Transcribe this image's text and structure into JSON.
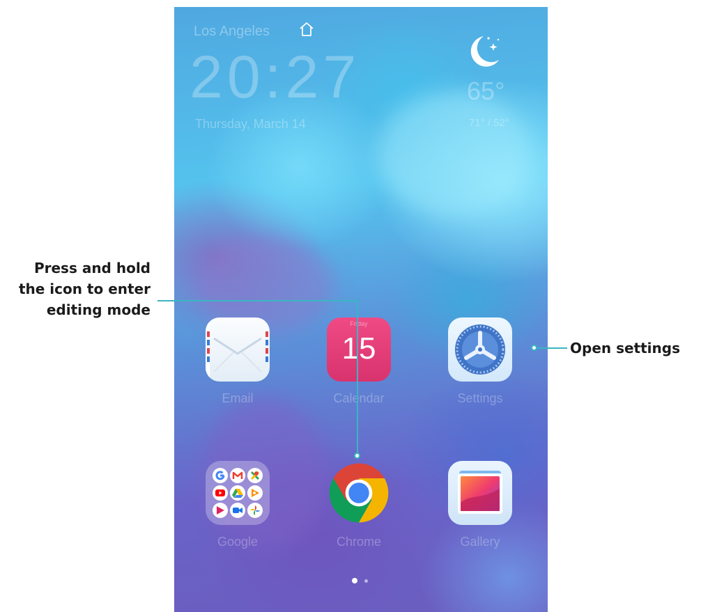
{
  "widget": {
    "city": "Los Angeles",
    "time": "20:27",
    "date": "Thursday, March 14",
    "temperature": "65°",
    "range": "71° / 52°"
  },
  "apps": {
    "email": {
      "label": "Email",
      "icon": "email-icon"
    },
    "calendar": {
      "label": "Calendar",
      "day": "Friday",
      "date": "15",
      "icon": "calendar-icon"
    },
    "settings": {
      "label": "Settings",
      "icon": "settings-icon"
    },
    "google": {
      "label": "Google",
      "icon": "google-folder-icon"
    },
    "chrome": {
      "label": "Chrome",
      "icon": "chrome-icon"
    },
    "gallery": {
      "label": "Gallery",
      "icon": "gallery-icon"
    }
  },
  "pager": {
    "pages": 2,
    "current": 1
  },
  "callouts": {
    "left": [
      "Press and hold",
      "the icon to enter",
      "editing mode"
    ],
    "right": "Open settings"
  },
  "colors": {
    "callout_line": "#39b6c2",
    "calendar_red": "#e03b77"
  }
}
